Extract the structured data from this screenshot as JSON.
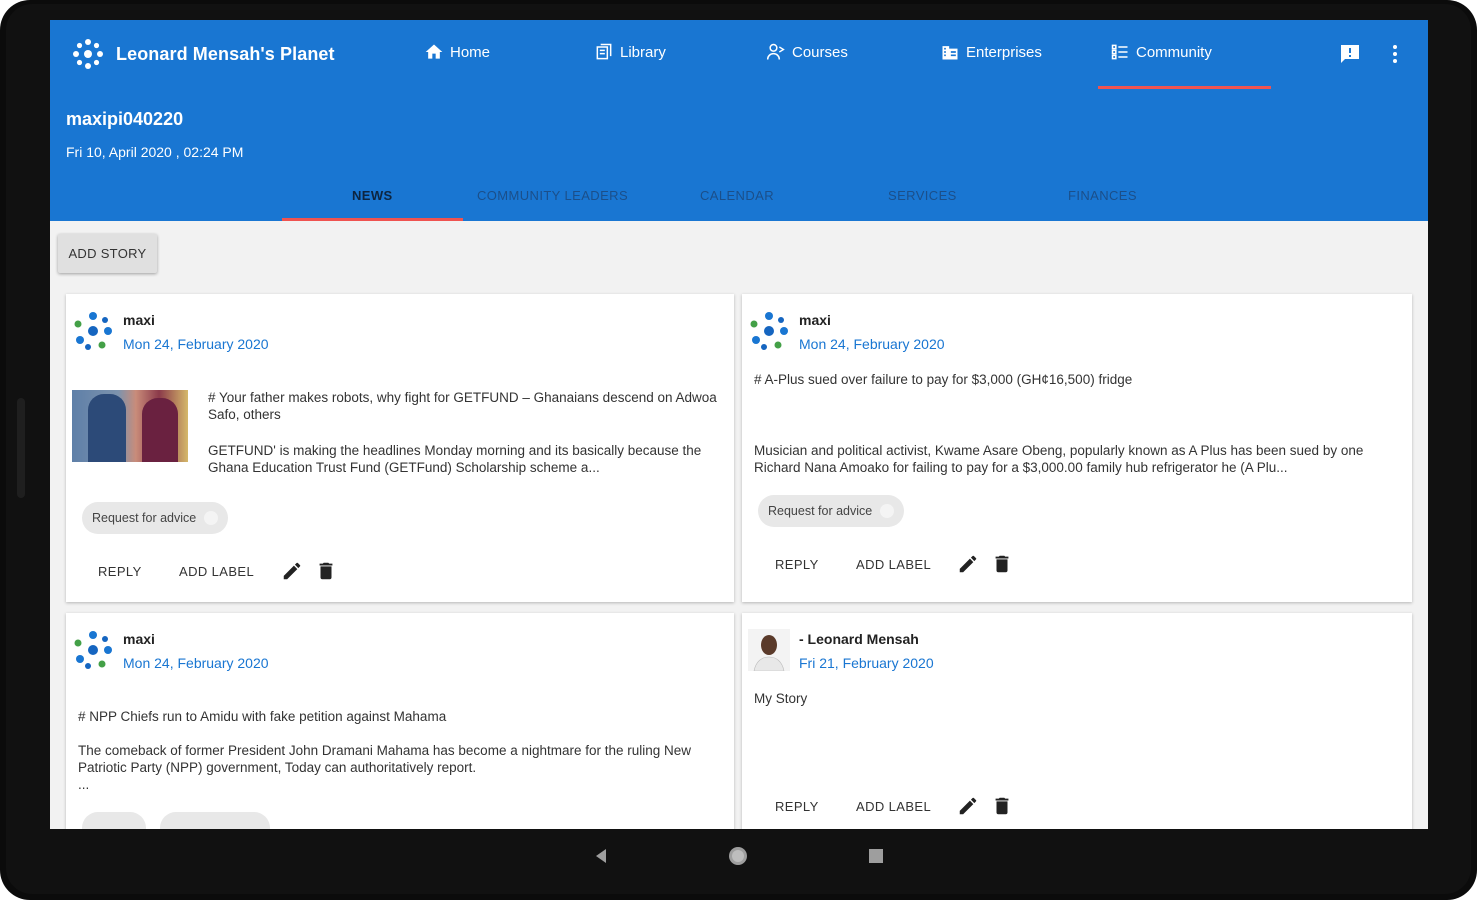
{
  "app": {
    "title": "Leonard Mensah's Planet",
    "nav": [
      {
        "label": "Home",
        "icon": "home-icon"
      },
      {
        "label": "Library",
        "icon": "library-icon"
      },
      {
        "label": "Courses",
        "icon": "courses-icon"
      },
      {
        "label": "Enterprises",
        "icon": "enterprises-icon"
      },
      {
        "label": "Community",
        "icon": "community-icon",
        "active": true
      }
    ],
    "header_icons": [
      "feedback-icon",
      "more-vert-icon"
    ]
  },
  "user": {
    "name": "maxipi040220",
    "datetime": "Fri 10, April 2020 , 02:24 PM"
  },
  "tabs": [
    "News",
    "Community Leaders",
    "Calendar",
    "Services",
    "Finances"
  ],
  "active_tab": "News",
  "add_story_label": "ADD STORY",
  "posts": [
    {
      "author": "maxi",
      "date": "Mon 24, February 2020",
      "headline": "# Your father makes robots, why fight for GETFUND – Ghanaians descend on Adwoa Safo, others",
      "body": "GETFUND' is making the headlines Monday morning and its basically because the Ghana Education Trust Fund (GETFund) Scholarship scheme a...",
      "chip": "Request for advice",
      "actions": [
        "REPLY",
        "ADD LABEL"
      ]
    },
    {
      "author": "maxi",
      "date": "Mon 24, February 2020",
      "headline": "# A-Plus sued over failure to pay for $3,000 (GH¢16,500) fridge",
      "body": "Musician and political activist, Kwame Asare Obeng, popularly known as A Plus has been sued by one Richard Nana Amoako for failing to pay for a $3,000.00 family hub refrigerator he (A Plu...",
      "chip": "Request for advice",
      "actions": [
        "REPLY",
        "ADD LABEL"
      ]
    },
    {
      "author": "maxi",
      "date": "Mon 24, February 2020",
      "headline": "# NPP Chiefs run to Amidu with fake petition against Mahama",
      "body": "The comeback of former President John Dramani Mahama has become a nightmare for the ruling New Patriotic Party (NPP) government, Today can authoritatively report.",
      "ellipsis": "..."
    },
    {
      "author": "- Leonard Mensah",
      "date": "Fri 21, February 2020",
      "body": "My Story",
      "actions": [
        "REPLY",
        "ADD LABEL"
      ]
    }
  ],
  "colors": {
    "primary": "#1976d2",
    "accent": "#ef5350",
    "link": "#1976d2"
  },
  "system_nav": [
    "back-icon",
    "home-circle-icon",
    "recents-icon"
  ]
}
